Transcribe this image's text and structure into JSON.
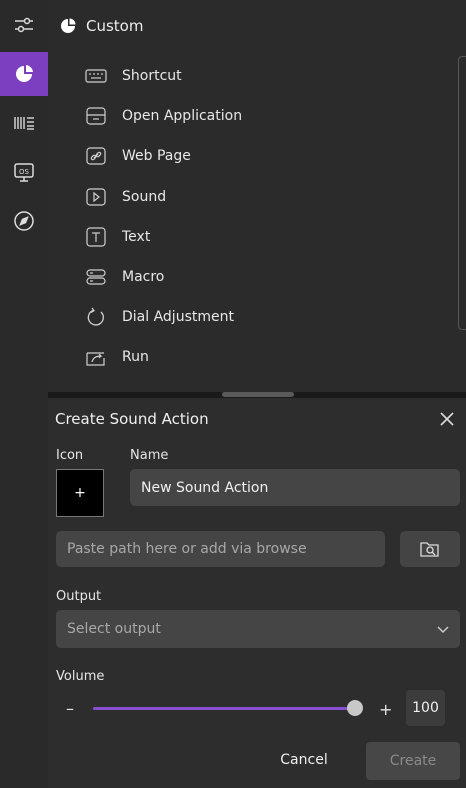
{
  "sidebar": {
    "items": [
      {
        "name": "sliders-icon"
      },
      {
        "name": "custom-pie-icon",
        "active": true
      },
      {
        "name": "barcode-icon"
      },
      {
        "name": "monitor-os-icon"
      },
      {
        "name": "compass-icon"
      }
    ]
  },
  "custom_panel": {
    "title": "Custom",
    "actions": [
      {
        "label": "Shortcut",
        "icon": "keyboard-icon"
      },
      {
        "label": "Open Application",
        "icon": "application-window-icon"
      },
      {
        "label": "Web Page",
        "icon": "link-icon"
      },
      {
        "label": "Sound",
        "icon": "play-icon"
      },
      {
        "label": "Text",
        "icon": "text-t-icon"
      },
      {
        "label": "Macro",
        "icon": "macro-icon"
      },
      {
        "label": "Dial Adjustment",
        "icon": "rotate-icon"
      },
      {
        "label": "Run",
        "icon": "run-share-icon"
      }
    ]
  },
  "dialog": {
    "title": "Create Sound Action",
    "icon_label": "Icon",
    "icon_placeholder": "+",
    "name_label": "Name",
    "name_value": "New Sound Action",
    "path_placeholder": "Paste path here or add via browse",
    "output_label": "Output",
    "output_placeholder": "Select output",
    "volume_label": "Volume",
    "volume_minus": "–",
    "volume_plus": "+",
    "volume_value": "100",
    "volume_level": 1.0,
    "cancel_label": "Cancel",
    "create_label": "Create"
  },
  "colors": {
    "accent": "#7b3fc0",
    "slider": "#8a4fd0"
  }
}
